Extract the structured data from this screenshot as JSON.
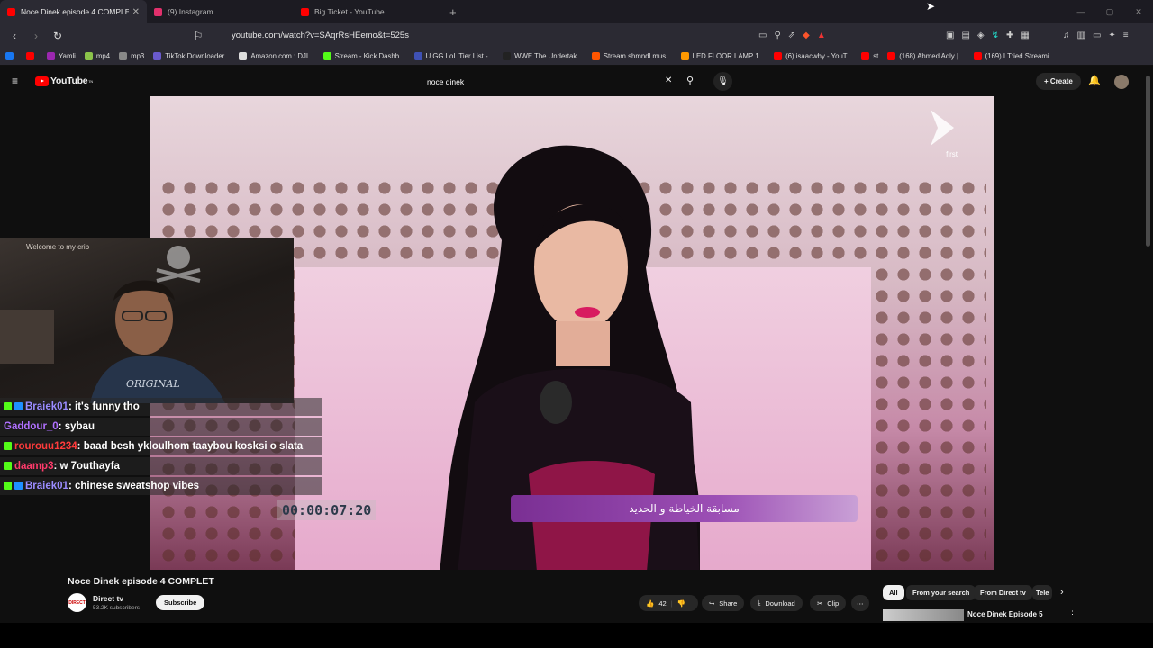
{
  "browser": {
    "tabs": [
      {
        "title": "Noce Dinek episode 4 COMPLETE",
        "color": "#ff0000",
        "active": true
      },
      {
        "title": "(9) Instagram",
        "color": "#e1306c",
        "active": false
      },
      {
        "title": "Big Ticket - YouTube",
        "color": "#ff0000",
        "active": false
      }
    ],
    "url": "youtube.com/watch?v=SAqrRsHEemo&t=525s",
    "bookmarks": [
      {
        "label": "",
        "color": "#1877f2"
      },
      {
        "label": "",
        "color": "#ff0000"
      },
      {
        "label": "Yamli",
        "color": "#9c27b0"
      },
      {
        "label": "mp4",
        "color": "#8bc34a"
      },
      {
        "label": "mp3",
        "color": "#888888"
      },
      {
        "label": "TikTok Downloader...",
        "color": "#6a5acd"
      },
      {
        "label": "Amazon.com : DJI...",
        "color": "#dddddd"
      },
      {
        "label": "Stream - Kick Dashb...",
        "color": "#53fc18"
      },
      {
        "label": "U.GG LoL Tier List -...",
        "color": "#3f51b5"
      },
      {
        "label": "WWE The Undertak...",
        "color": "#222222"
      },
      {
        "label": "Stream shmndl mus...",
        "color": "#ff5500"
      },
      {
        "label": "LED FLOOR LAMP 1...",
        "color": "#ff9800"
      },
      {
        "label": "(6) isaacwhy - YouT...",
        "color": "#ff0000"
      },
      {
        "label": "st",
        "color": "#ff0000"
      },
      {
        "label": "(168) Ahmed Adly |...",
        "color": "#ff0000"
      },
      {
        "label": "(169) I Tried Streami...",
        "color": "#ff0000"
      }
    ]
  },
  "youtube": {
    "logo": "YouTube",
    "logo_sup": "TN",
    "search_value": "noce dinek",
    "create_label": "Create"
  },
  "video": {
    "caption": "مسابقة الخياطة و الحديد",
    "channel_watermark": "first",
    "timer": "00:00:07:20",
    "webcam_sign": "Welcome to my crib",
    "shirt_text": "ORIGINAL"
  },
  "chat": [
    {
      "user": "Braiek01",
      "user_color": "#9b8cff",
      "text": ": it's funny tho",
      "badge_colors": [
        "#53fc18",
        "#1e90ff"
      ]
    },
    {
      "user": "Gaddour_0",
      "user_color": "#b070ff",
      "text": ": sybau",
      "badge_colors": []
    },
    {
      "user": "rourouu1234",
      "user_color": "#ff3b3b",
      "text": ": baad besh ykloulhom taaybou kosksi o slata",
      "badge_colors": [
        "#53fc18"
      ]
    },
    {
      "user": "daamp3",
      "user_color": "#ff3b6b",
      "text": ": w 7outhayfa",
      "badge_colors": [
        "#53fc18"
      ]
    },
    {
      "user": "Braiek01",
      "user_color": "#9b8cff",
      "text": ": chinese sweatshop vibes",
      "badge_colors": [
        "#53fc18",
        "#1e90ff"
      ]
    }
  ],
  "watch": {
    "title": "Noce Dinek episode 4 COMPLET",
    "channel": "Direct tv",
    "avatar_text": "DIRECT",
    "subscribers": "53.2K subscribers",
    "subscribe_label": "Subscribe",
    "likes": "42",
    "share_label": "Share",
    "download_label": "Download",
    "clip_label": "Clip"
  },
  "related": {
    "chips": [
      "All",
      "From your search",
      "From Direct tv",
      "Tele"
    ],
    "first_title": "Noce Dinek Episode 5"
  }
}
